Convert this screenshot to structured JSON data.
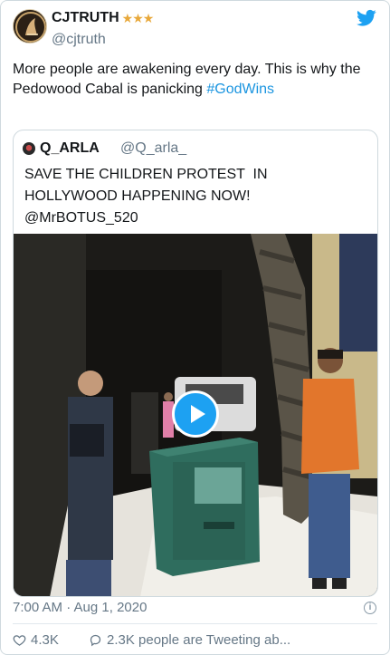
{
  "author": {
    "display_name": "CJTRUTH",
    "badge": "★★★",
    "handle": "@cjtruth",
    "avatar_icon": "profile-avatar"
  },
  "tweet": {
    "text_main": "More people are awakening every day. This is why the Pedowood Cabal is panicking ",
    "hashtag": "#GodWins"
  },
  "quoted": {
    "display_name": "Q_ARLA",
    "handle": "@Q_arla_",
    "text": "SAVE THE CHILDREN PROTEST  IN\nHOLLYWOOD HAPPENING NOW!\n@MrBOTUS_520"
  },
  "footer": {
    "timestamp": "7:00 AM · Aug 1, 2020",
    "likes": "4.3K",
    "conversation": "2.3K people are Tweeting ab..."
  },
  "colors": {
    "link": "#1b95e0",
    "twitter_blue": "#1da1f2",
    "secondary_text": "#657786",
    "star": "#e8a83a"
  }
}
